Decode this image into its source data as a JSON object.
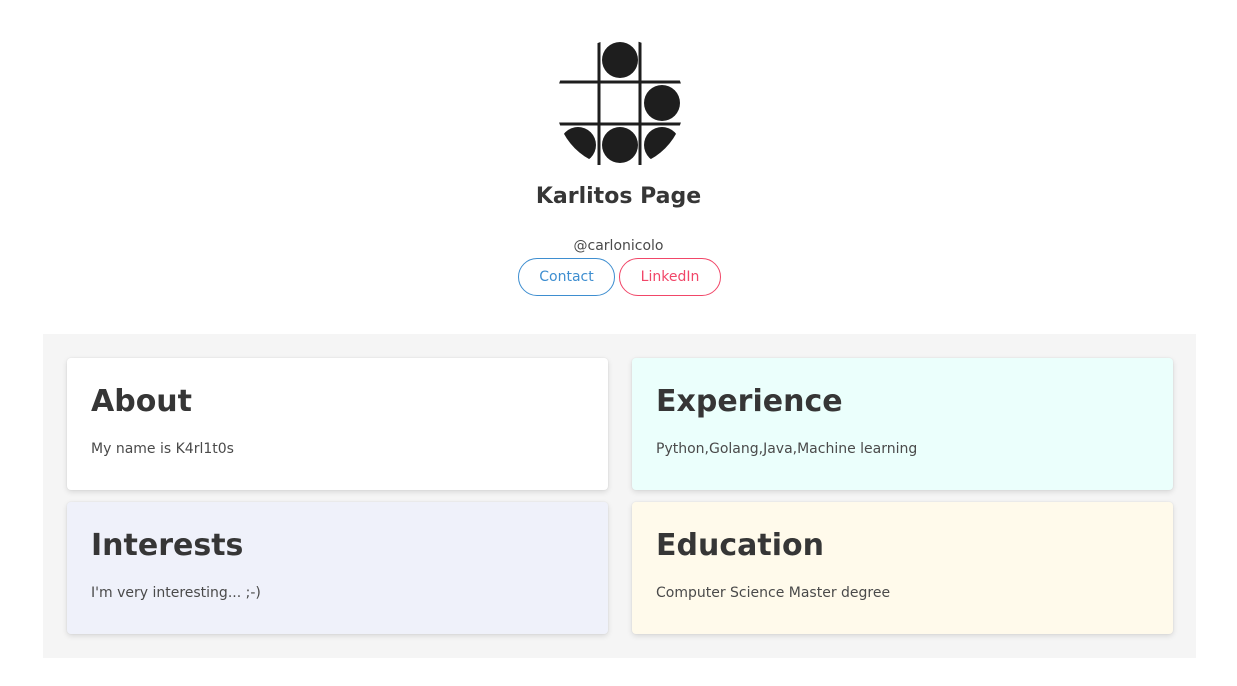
{
  "profile": {
    "title": "Karlitos Page",
    "handle": "@carlonicolo",
    "avatar_icon": "go-board-pattern-icon"
  },
  "buttons": {
    "contact": "Contact",
    "linkedin": "LinkedIn"
  },
  "colors": {
    "contact_accent": "#3e8ed0",
    "linkedin_accent": "#f14668",
    "section_bg": "#f5f5f5",
    "about_bg": "#ffffff",
    "experience_bg": "#ebfffc",
    "interests_bg": "#eff1fa",
    "education_bg": "#fffaeb"
  },
  "cards": {
    "about": {
      "title": "About",
      "text": "My name is K4rl1t0s"
    },
    "experience": {
      "title": "Experience",
      "text": "Python,Golang,Java,Machine learning"
    },
    "interests": {
      "title": "Interests",
      "text": "I'm very interesting... ;-)"
    },
    "education": {
      "title": "Education",
      "text": "Computer Science Master degree"
    }
  }
}
